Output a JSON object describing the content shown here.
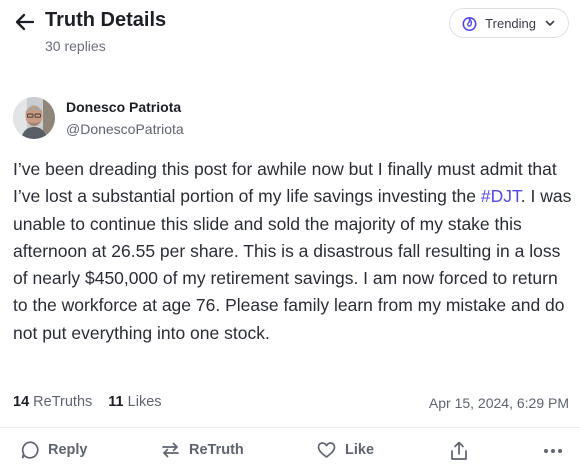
{
  "header": {
    "title": "Truth Details",
    "subtitle": "30 replies",
    "feed_selector": "Trending"
  },
  "post": {
    "author_name": "Donesco Patriota",
    "author_handle": "@DonescoPatriota",
    "text_before": "I’ve been dreading this post for awhile now but I finally must admit that I’ve lost a substantial portion of my life savings investing the ",
    "hashtag": "#DJT",
    "text_after": ". I was unable to continue this slide and sold the majority of my stake this afternoon at 26.55 per share. This is a disastrous fall resulting in a loss of nearly $450,000 of my retirement savings. I am now forced to return to the workforce at age 76. Please family learn from my mistake and do not put everything into one stock.",
    "retruths_count": "14",
    "retruths_label": "ReTruths",
    "likes_count": "11",
    "likes_label": "Likes",
    "timestamp": "Apr 15, 2024, 6:29 PM"
  },
  "actions": {
    "reply": "Reply",
    "retruth": "ReTruth",
    "like": "Like"
  },
  "colors": {
    "accent": "#5448ee",
    "muted": "#5f6470"
  }
}
